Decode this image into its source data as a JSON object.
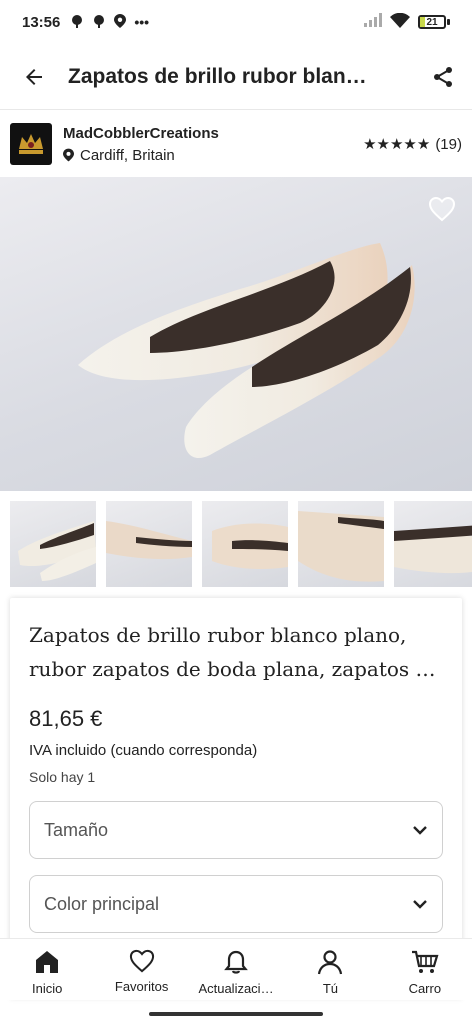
{
  "status_bar": {
    "time": "13:56",
    "battery_level": "21",
    "battery_fill_fraction": 0.21
  },
  "header": {
    "title": "Zapatos de brillo rubor blan…"
  },
  "shop": {
    "name": "MadCobblerCreations",
    "location": "Cardiff, Britain",
    "stars": "★★★★★",
    "review_count": "(19)",
    "rating": 5
  },
  "product": {
    "title": "Zapatos de brillo rubor blanco plano, rubor zapatos de boda plana, zapatos de novia",
    "price": "81,65 €",
    "tax_note": "IVA incluido (cuando corresponda)",
    "stock_note": "Solo hay 1"
  },
  "options": [
    {
      "label": "Tamaño"
    },
    {
      "label": "Color principal"
    }
  ],
  "bottom_nav": [
    {
      "label": "Inicio",
      "icon": "home-icon"
    },
    {
      "label": "Favoritos",
      "icon": "heart-icon"
    },
    {
      "label": "Actualizaci…",
      "icon": "bell-icon"
    },
    {
      "label": "Tú",
      "icon": "person-icon"
    },
    {
      "label": "Carro",
      "icon": "cart-icon"
    }
  ],
  "colors": {
    "shoe_white": "#f3f1ea",
    "shoe_blush": "#ecd9c6",
    "lining": "#3a2f2a",
    "background": "#d9dbe2"
  }
}
